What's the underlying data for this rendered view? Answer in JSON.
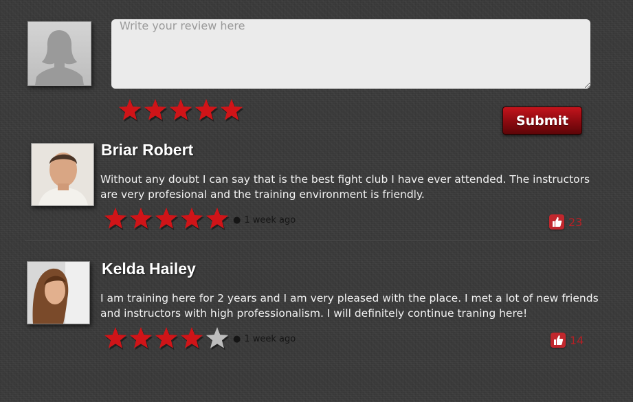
{
  "composer": {
    "placeholder": "Write your review here",
    "rating": 5,
    "submit_label": "Submit"
  },
  "colors": {
    "star_filled": "#d01418",
    "star_empty": "#bcbcbc",
    "accent": "#c1272d"
  },
  "reviews": [
    {
      "name": "Briar Robert",
      "text": "Without any doubt I can say that is the best fight club I have ever attended. The instructors are very profesional and the training environment is friendly.",
      "rating": 5,
      "time": "1 week ago",
      "likes": "23"
    },
    {
      "name": "Kelda Hailey",
      "text": "I am training here for 2 years and I am very pleased with the place. I met a lot of new friends and instructors with high professionalism. I will definitely continue traning here!",
      "rating": 4,
      "time": "1 week ago",
      "likes": "14"
    }
  ]
}
